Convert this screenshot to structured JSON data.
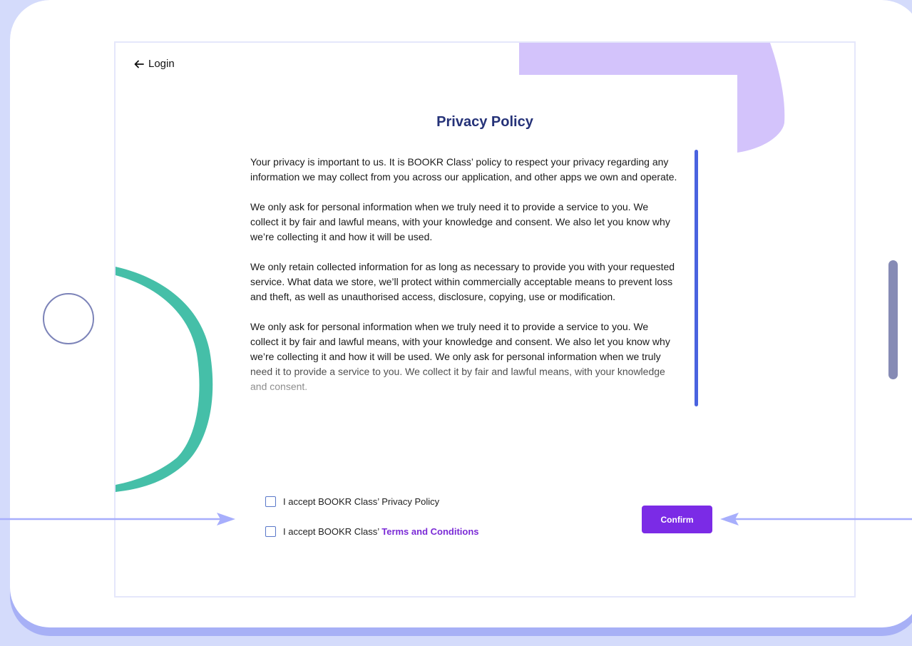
{
  "header": {
    "back_label": "Login"
  },
  "page": {
    "title": "Privacy Policy"
  },
  "policy": {
    "paragraphs": [
      "Your privacy is important to us. It is BOOKR Class’ policy to respect your privacy regarding any information we may collect from you across our application, and other apps we own and operate.",
      "We only ask for personal information when we truly need it to provide a service to you. We collect it by fair and lawful means, with your knowledge and consent. We also let you know why we’re collecting it and how it will be used.",
      "We only retain collected information for as long as necessary to provide you with your requested service. What data we store, we’ll protect within commercially acceptable means to prevent loss and theft, as well as unauthorised access, disclosure, copying, use or modification.",
      "We only ask for personal information when we truly need it to provide a service to you. We collect it by fair and lawful means, with your knowledge and consent. We also let you know why we’re collecting it and how it will be used. We only ask for personal information when we truly need it to provide a service to you. We collect it by fair and lawful means, with your knowledge and consent."
    ]
  },
  "consent": {
    "privacy_label": "I accept BOOKR Class’ Privacy Policy",
    "terms_prefix": "I accept BOOKR Class’ ",
    "terms_link": "Terms and Conditions"
  },
  "actions": {
    "confirm_label": "Confirm"
  },
  "colors": {
    "title": "#253278",
    "accent_purple": "#7b2be6",
    "scrollbar": "#4a63e0",
    "deco_teal": "#45bfa8",
    "deco_lavender": "#d3c3fb",
    "arrow": "#a7aefc"
  },
  "icons": {
    "back": "arrow-left-icon",
    "home_button": "home-button-icon"
  }
}
